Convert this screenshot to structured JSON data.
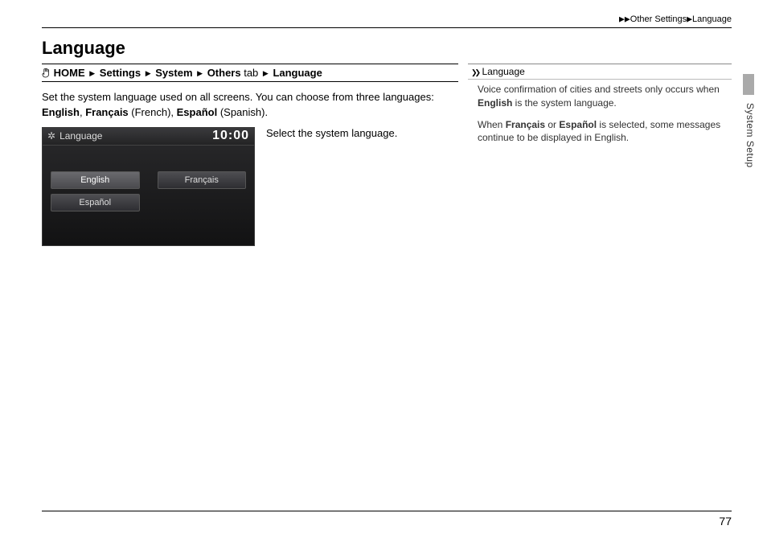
{
  "header": {
    "bc1": "Other Settings",
    "bc2": "Language"
  },
  "title": "Language",
  "nav": {
    "home": "HOME",
    "settings": "Settings",
    "system": "System",
    "others": "Others",
    "tab_word": " tab ",
    "language": "Language"
  },
  "intro": {
    "line1": "Set the system language used on all screens. You can choose from three languages:",
    "english": "English",
    "sep1": ", ",
    "francais": "Français",
    "french_paren": " (French), ",
    "espanol": "Español",
    "spanish_paren": " (Spanish)."
  },
  "device": {
    "title": "Language",
    "clock": "10:00",
    "btn1": "English",
    "btn2": "Français",
    "btn3": "Español"
  },
  "instruction": "Select the system language.",
  "sidebar": {
    "heading": "Language",
    "p1a": "Voice confirmation of cities and streets only occurs when ",
    "p1b": "English",
    "p1c": " is the system language.",
    "p2a": "When ",
    "p2b": "Français",
    "p2c": " or ",
    "p2d": "Español",
    "p2e": " is selected, some messages continue to be displayed in English."
  },
  "section_label": "System Setup",
  "page_number": "77"
}
